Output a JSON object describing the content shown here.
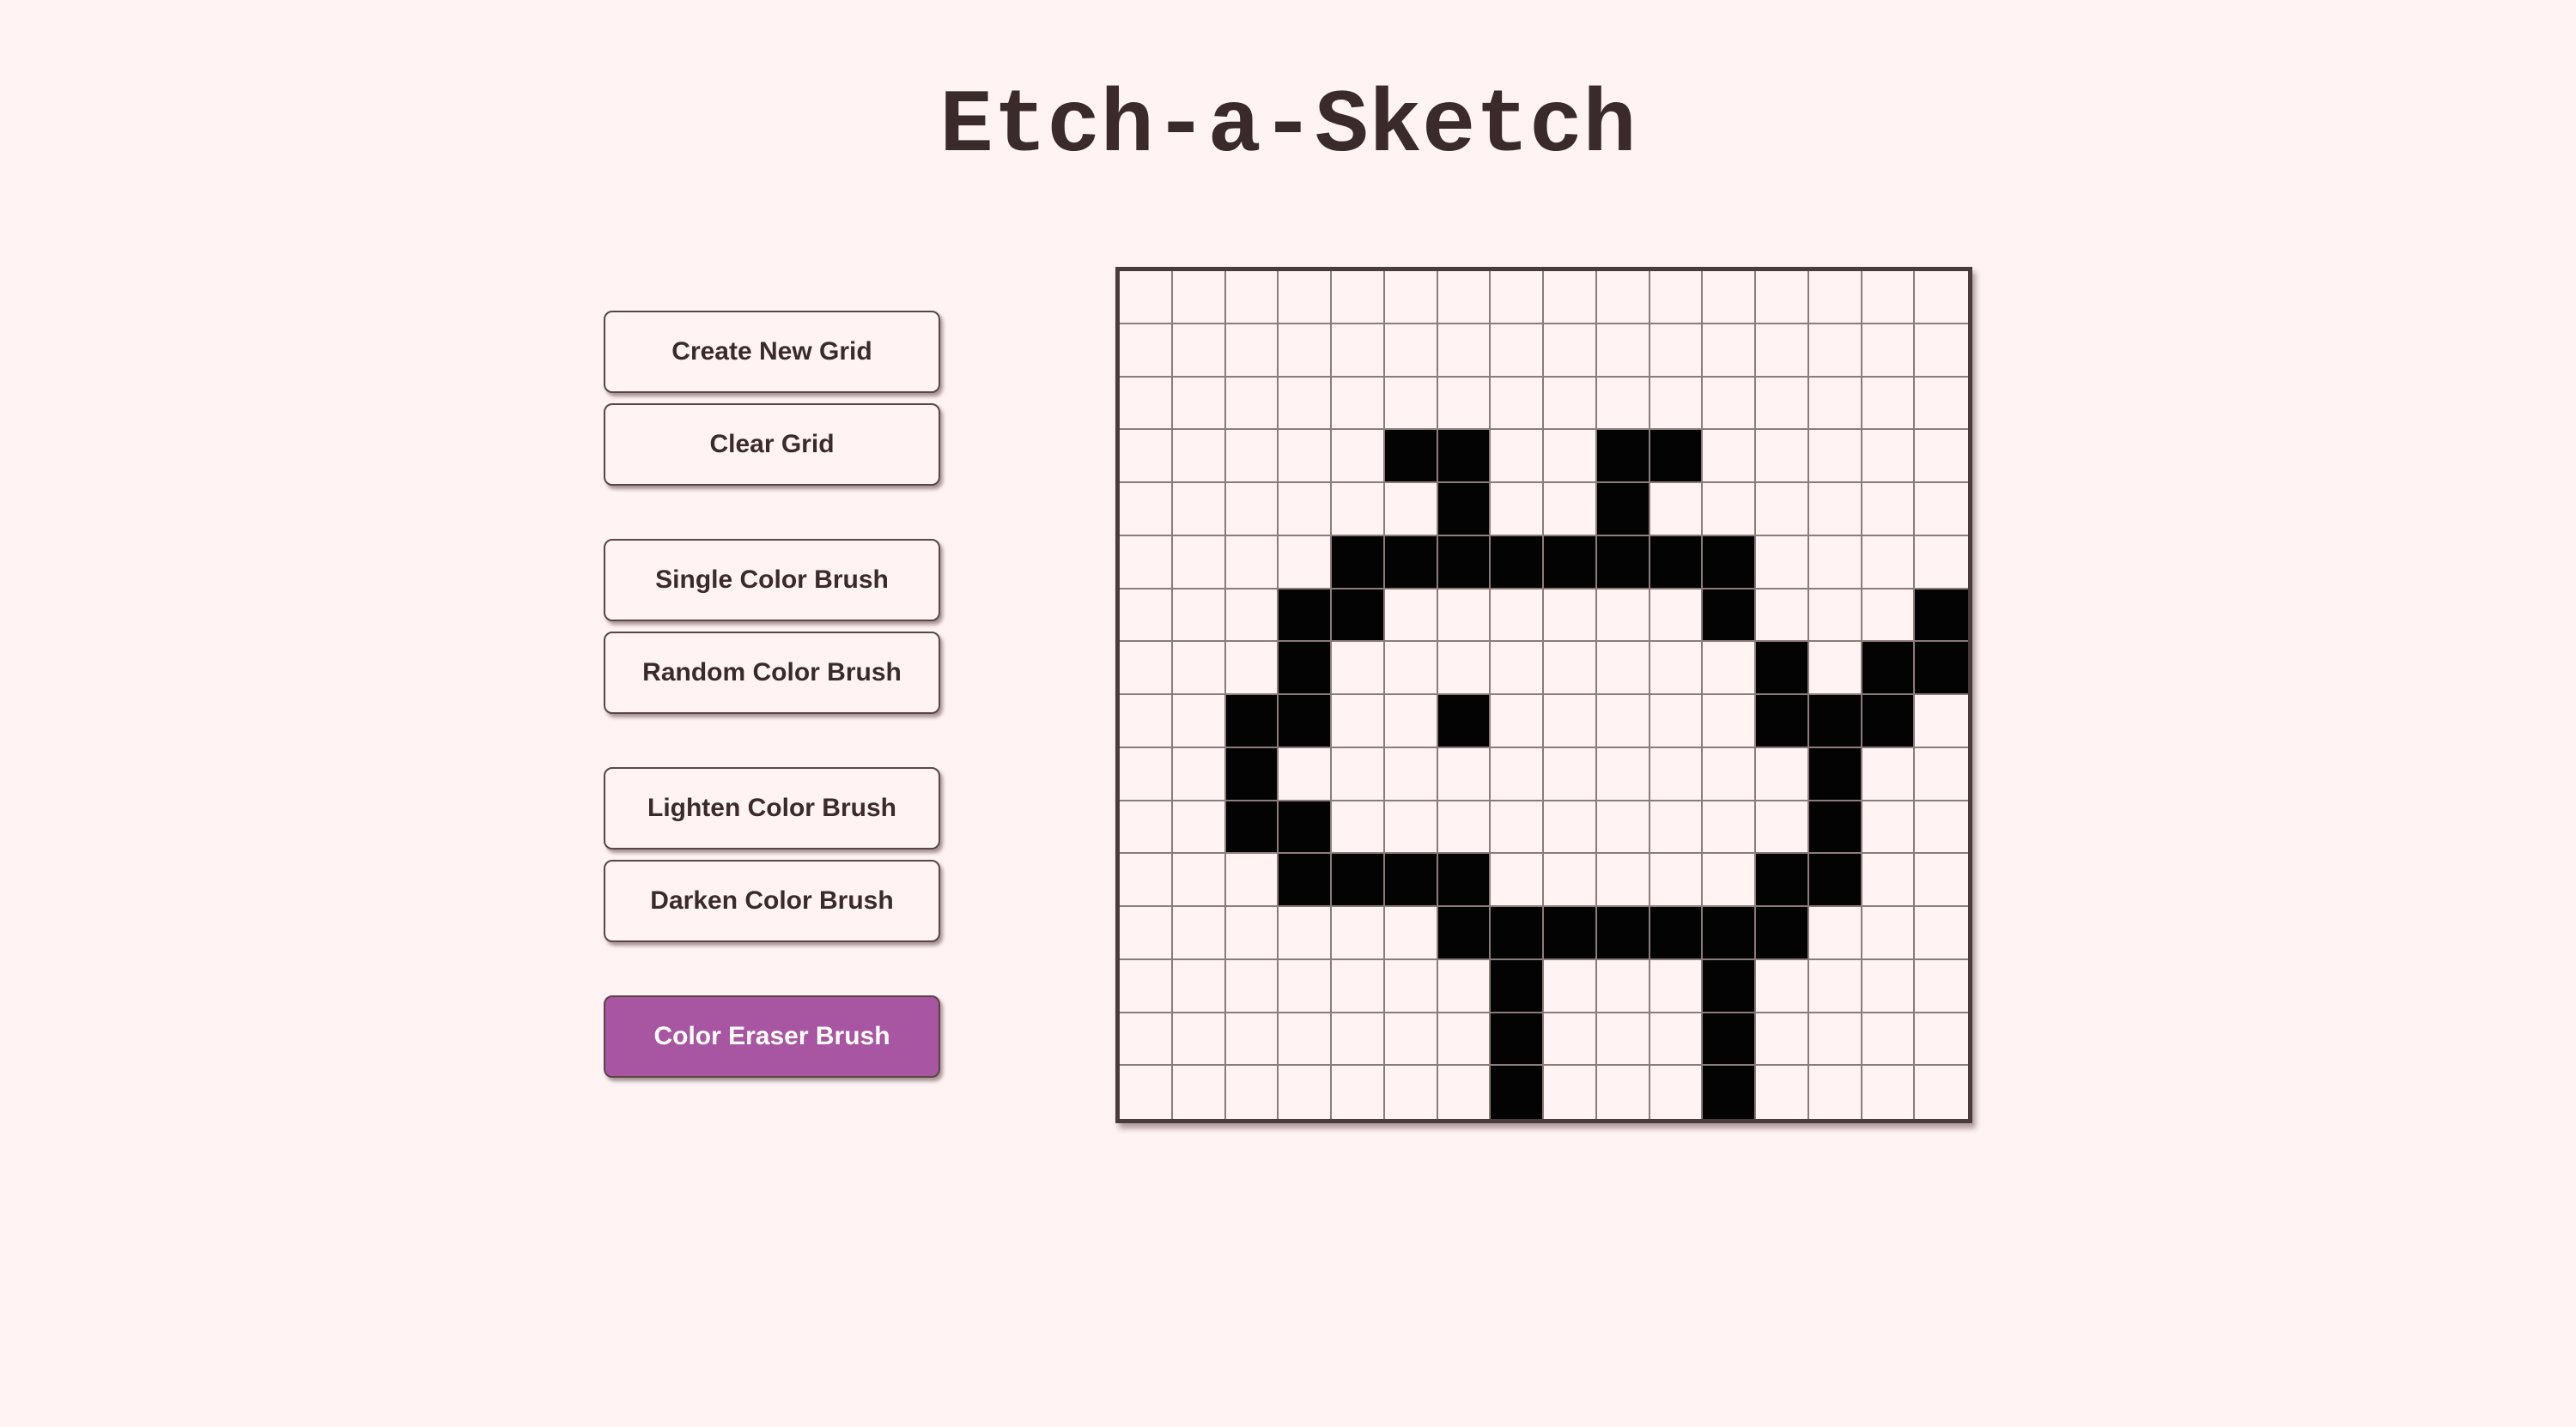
{
  "page": {
    "title": "Etch-a-Sketch"
  },
  "controls": {
    "create_new_grid": "Create New Grid",
    "clear_grid": "Clear Grid",
    "single_color_brush": "Single Color Brush",
    "random_color_brush": "Random Color Brush",
    "lighten_color_brush": "Lighten Color Brush",
    "darken_color_brush": "Darken Color Brush",
    "color_eraser_brush": "Color Eraser Brush",
    "active_brush": "color_eraser_brush"
  },
  "grid": {
    "size": 16,
    "cell_color": "#fff3f3",
    "filled_color": "#030303",
    "filled_cells": [
      [
        3,
        5
      ],
      [
        3,
        6
      ],
      [
        3,
        9
      ],
      [
        3,
        10
      ],
      [
        4,
        6
      ],
      [
        4,
        9
      ],
      [
        5,
        4
      ],
      [
        5,
        5
      ],
      [
        5,
        6
      ],
      [
        5,
        7
      ],
      [
        5,
        8
      ],
      [
        5,
        9
      ],
      [
        5,
        10
      ],
      [
        5,
        11
      ],
      [
        6,
        3
      ],
      [
        6,
        4
      ],
      [
        6,
        11
      ],
      [
        6,
        15
      ],
      [
        7,
        3
      ],
      [
        7,
        12
      ],
      [
        7,
        14
      ],
      [
        7,
        15
      ],
      [
        8,
        2
      ],
      [
        8,
        3
      ],
      [
        8,
        6
      ],
      [
        8,
        12
      ],
      [
        8,
        13
      ],
      [
        8,
        14
      ],
      [
        9,
        2
      ],
      [
        9,
        13
      ],
      [
        10,
        2
      ],
      [
        10,
        3
      ],
      [
        10,
        13
      ],
      [
        11,
        3
      ],
      [
        11,
        4
      ],
      [
        11,
        5
      ],
      [
        11,
        6
      ],
      [
        11,
        12
      ],
      [
        11,
        13
      ],
      [
        12,
        6
      ],
      [
        12,
        7
      ],
      [
        12,
        8
      ],
      [
        12,
        9
      ],
      [
        12,
        10
      ],
      [
        12,
        11
      ],
      [
        12,
        12
      ],
      [
        13,
        7
      ],
      [
        13,
        11
      ],
      [
        14,
        7
      ],
      [
        14,
        11
      ],
      [
        15,
        7
      ],
      [
        15,
        11
      ]
    ]
  },
  "colors": {
    "background": "#fff3f3",
    "text": "#3b2a2a",
    "accent": "#a855a2",
    "grid_border": "#4a3c3c",
    "grid_lines": "#8c7b7b"
  }
}
